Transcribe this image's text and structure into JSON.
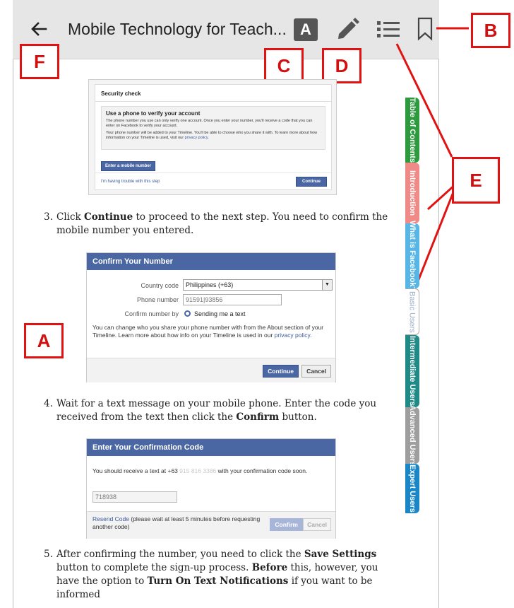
{
  "toolbar": {
    "title": "Mobile Technology for Teach...",
    "font_icon_letter": "A"
  },
  "callouts": {
    "a": "A",
    "b": "B",
    "c": "C",
    "d": "D",
    "e": "E",
    "f": "F"
  },
  "security_check": {
    "title": "Security check",
    "heading": "Use a phone to verify your account",
    "para1": "The phone number you use can only verify one account. Once you enter your number, you'll receive a code that you can enter on Facebook to verify your account.",
    "para2_a": "Your phone number will be added to your Timeline. You'll be able to choose who you share it with. To learn more about how information on your Timeline is used, visit our",
    "para2_link": "privacy policy",
    "enter_button": "Enter a mobile number",
    "trouble_link": "I'm having trouble with this step",
    "continue_button": "Continue"
  },
  "step3": {
    "num": "3.",
    "text_a": "Click",
    "bold": "Continue",
    "text_b": "to proceed to the next step. You need to confirm the mobile number you entered."
  },
  "confirm_number": {
    "title": "Confirm Your Number",
    "country_label": "Country code",
    "country_value": "Philippines (+63)",
    "phone_label": "Phone number",
    "phone_value": "91591|93856",
    "confirm_by_label": "Confirm number by",
    "confirm_by_value": "Sending me a text",
    "note_a": "You can change who you share your phone number with from the About section of your Timeline. Learn more about how info on your Timeline is used in our",
    "note_link": "privacy policy",
    "continue_button": "Continue",
    "cancel_button": "Cancel"
  },
  "step4": {
    "num": "4.",
    "text_a": "Wait for a text message on your mobile phone. Enter the code you received from the text then click the",
    "bold": "Confirm",
    "text_b": "button."
  },
  "confirmation_code": {
    "title": "Enter Your Confirmation Code",
    "message_a": "You should receive a text at +63",
    "message_blur": "915 816 3386",
    "message_b": "with your confirmation code soon.",
    "code_value": "718938",
    "resend_link": "Resend Code",
    "resend_note": "(please wait at least 5 minutes before requesting another code)",
    "confirm_button": "Confirm",
    "cancel_button": "Cancel"
  },
  "step5": {
    "num": "5.",
    "t1": "After confirming the number, you need to click the",
    "b1": "Save Settings",
    "t2": "button to complete the sign-up process.",
    "b2": "Before",
    "t3": "this, however, you have the option to",
    "b3": "Turn On Text Notifications",
    "t4": "if you want to be informed"
  },
  "side_tabs": [
    {
      "label": "Table of Contents",
      "color": "#2e9a3e"
    },
    {
      "label": "Introduction",
      "color": "#ef8a86"
    },
    {
      "label": "What is Facebook?",
      "color": "#58b6e6"
    },
    {
      "label": "Basic Users",
      "color": "#ffffff"
    },
    {
      "label": "Intermediate Users",
      "color": "#1f8a86"
    },
    {
      "label": "Advanced Users",
      "color": "#9e9e9e"
    },
    {
      "label": "Expert Users",
      "color": "#1a86c8"
    }
  ],
  "colors": {
    "callout_red": "#e01212",
    "facebook_blue": "#4a67a4"
  }
}
